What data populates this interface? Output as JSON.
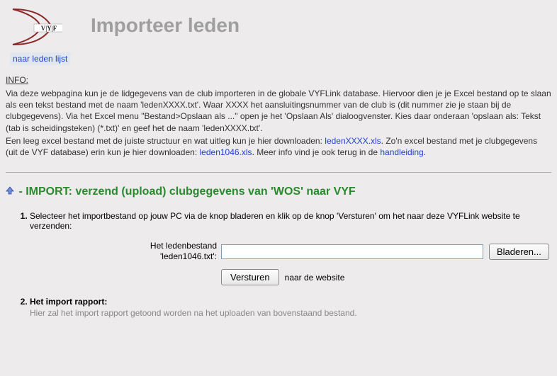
{
  "header": {
    "logo_letters": "V|Y|F",
    "page_title": "Importeer leden",
    "back_link": "naar leden lijst"
  },
  "info": {
    "heading": "INFO:",
    "p1": "Via deze webpagina kun je de lidgegevens van de club importeren in de globale VYFLink database. Hiervoor dien je je Excel bestand op te slaan als een tekst bestand met de naam 'ledenXXXX.txt'. Waar XXXX het aansluitingsnummer van de club is (dit nummer zie je staan bij de clubgegevens). Via het Excel menu \"Bestand>Opslaan als ...\" open je het 'Opslaan Als' dialoogvenster. Kies daar onderaan 'opslaan als: Tekst (tab is scheidingsteken) (*.txt)' en geef het de naam 'ledenXXXX.txt'.",
    "p2_pre": "Een leeg excel bestand met de juiste structuur en wat uitleg kun je hier downloaden: ",
    "p2_link1": "ledenXXXX.xls",
    "p2_mid": ". Zo'n excel bestand met je clubgegevens (uit de VYF database) erin kun je hier downloaden: ",
    "p2_link2": "leden1046.xls",
    "p2_post": ". Meer info vind je ook terug in de ",
    "p2_link3": "handleiding",
    "p2_end": "."
  },
  "section": {
    "heading": " - IMPORT: verzend (upload) clubgegevens van 'WOS' naar VYF"
  },
  "steps": {
    "s1": {
      "text": "Selecteer het importbestand op jouw PC via de knop bladeren en klik op de knop 'Versturen' om het naar deze VYFLink website te verzenden:",
      "label_line1": "Het ledenbestand",
      "label_line2": "'leden1046.txt':",
      "browse_label": "Bladeren...",
      "submit_label": "Versturen",
      "submit_suffix": "naar de website"
    },
    "s2": {
      "title": "Het import rapport:",
      "note": "Hier zal het import rapport getoond worden na het uploaden van bovenstaand bestand."
    }
  }
}
